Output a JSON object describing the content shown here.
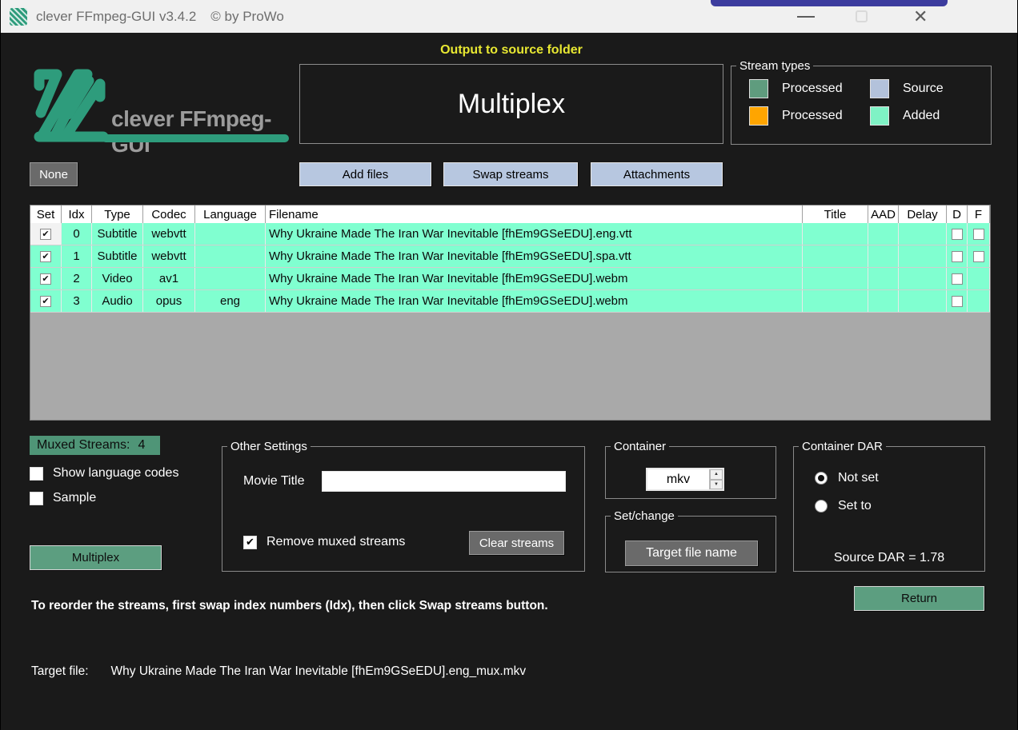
{
  "window": {
    "title": "clever FFmpeg-GUI v3.4.2",
    "copyright": "© by ProWo",
    "close_glyph": "✕"
  },
  "header": {
    "output_note": "Output to source folder",
    "mode_title": "Multiplex"
  },
  "stream_types": {
    "label": "Stream types",
    "items": [
      {
        "label": "Processed",
        "color": "#5f9c7e"
      },
      {
        "label": "Source",
        "color": "#b3c2db"
      },
      {
        "label": "Processed",
        "color": "#ffa500"
      },
      {
        "label": "Added",
        "color": "#7ff2c5"
      }
    ]
  },
  "toolbar": {
    "none": "None",
    "add_files": "Add files",
    "swap_streams": "Swap streams",
    "attachments": "Attachments"
  },
  "table": {
    "headers": [
      "Set",
      "Idx",
      "Type",
      "Codec",
      "Language",
      "Filename",
      "Title",
      "AAD",
      "Delay",
      "D",
      "F"
    ],
    "rows": [
      {
        "set": true,
        "idx": "0",
        "type": "Subtitle",
        "codec": "webvtt",
        "language": "",
        "filename": "Why Ukraine Made The Iran War Inevitable [fhEm9GSeEDU].eng.vtt",
        "title": "",
        "aad": "",
        "delay": "",
        "d": false,
        "f": false
      },
      {
        "set": true,
        "idx": "1",
        "type": "Subtitle",
        "codec": "webvtt",
        "language": "",
        "filename": "Why Ukraine Made The Iran War Inevitable [fhEm9GSeEDU].spa.vtt",
        "title": "",
        "aad": "",
        "delay": "",
        "d": false,
        "f": false
      },
      {
        "set": true,
        "idx": "2",
        "type": "Video",
        "codec": "av1",
        "language": "",
        "filename": "Why Ukraine Made The Iran War Inevitable [fhEm9GSeEDU].webm",
        "title": "",
        "aad": "",
        "delay": "",
        "d": false
      },
      {
        "set": true,
        "idx": "3",
        "type": "Audio",
        "codec": "opus",
        "language": "eng",
        "filename": "Why Ukraine Made The Iran War Inevitable [fhEm9GSeEDU].webm",
        "title": "",
        "aad": "",
        "delay": "",
        "d": false
      }
    ]
  },
  "left_panel": {
    "muxed_streams_label": "Muxed Streams:",
    "muxed_streams_count": "4",
    "show_language_codes": "Show language codes",
    "sample": "Sample",
    "multiplex_button": "Multiplex"
  },
  "other_settings": {
    "label": "Other Settings",
    "movie_title_label": "Movie Title",
    "movie_title_value": "",
    "remove_muxed": "Remove muxed streams",
    "clear_streams": "Clear streams"
  },
  "container_group": {
    "label": "Container",
    "value": "mkv"
  },
  "set_change": {
    "label": "Set/change",
    "target_file_name": "Target file name"
  },
  "container_dar": {
    "label": "Container DAR",
    "not_set": "Not set",
    "set_to": "Set to",
    "source_dar": "Source DAR = 1.78"
  },
  "footer": {
    "return_button": "Return",
    "instruction": "To reorder the streams, first swap index numbers (Idx), then click Swap streams button.",
    "target_file_label": "Target file:",
    "target_file_value": "Why Ukraine Made The Iran War Inevitable [fhEm9GSeEDU].eng_mux.mkv"
  },
  "colors": {
    "accent_green": "#2e9c7c",
    "button_green": "#5c9e80",
    "button_blue": "#b7c7e0",
    "button_gray": "#6a6a6a",
    "added_row_bg": "#80ffd0",
    "note_yellow": "#e8e832",
    "muxed_label_bg": "#4f9577",
    "titlebar_bg": "#f0f0f0",
    "window_bg": "#1a1a1a",
    "top_strip_blue": "#3c3c9e"
  }
}
